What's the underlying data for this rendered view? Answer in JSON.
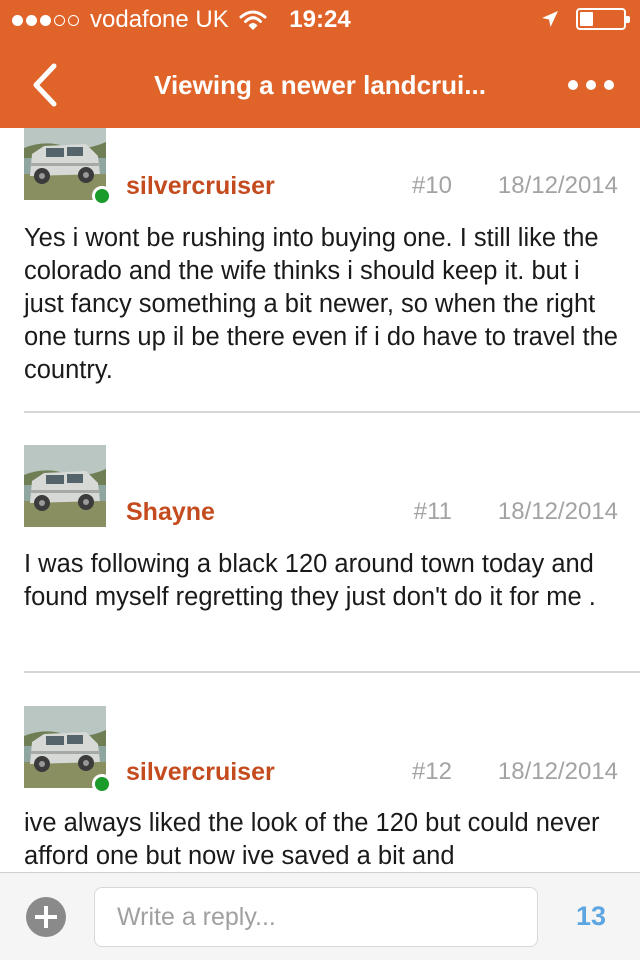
{
  "status_bar": {
    "carrier": "vodafone UK",
    "time": "19:24",
    "signal_bars": 3,
    "signal_total": 5,
    "battery_level": 0.3
  },
  "nav": {
    "title": "Viewing a newer landcrui...",
    "back_icon": "chevron-left-icon",
    "more_icon": "ellipsis-icon"
  },
  "colors": {
    "header": "#e06329",
    "username": "#c44b1e",
    "online": "#1a9b2a",
    "counter": "#5ea6e2"
  },
  "posts": [
    {
      "username": "silvercruiser",
      "number": "#10",
      "date": "18/12/2014",
      "online": true,
      "text": "Yes i wont be rushing into buying one. I still like the colorado and the wife thinks i should keep it. but i just fancy something a bit newer, so when the right one turns up il be there even if i do have to travel the country."
    },
    {
      "username": "Shayne",
      "number": "#11",
      "date": "18/12/2014",
      "online": false,
      "text": "I was following a black 120 around town today and found myself regretting they just don't do it for me ."
    },
    {
      "username": "silvercruiser",
      "number": "#12",
      "date": "18/12/2014",
      "online": true,
      "text": "ive always liked the look of the 120 but could never afford one but now ive saved a bit and"
    }
  ],
  "reply": {
    "placeholder": "Write a reply...",
    "value": ""
  },
  "footer": {
    "count": "13"
  }
}
